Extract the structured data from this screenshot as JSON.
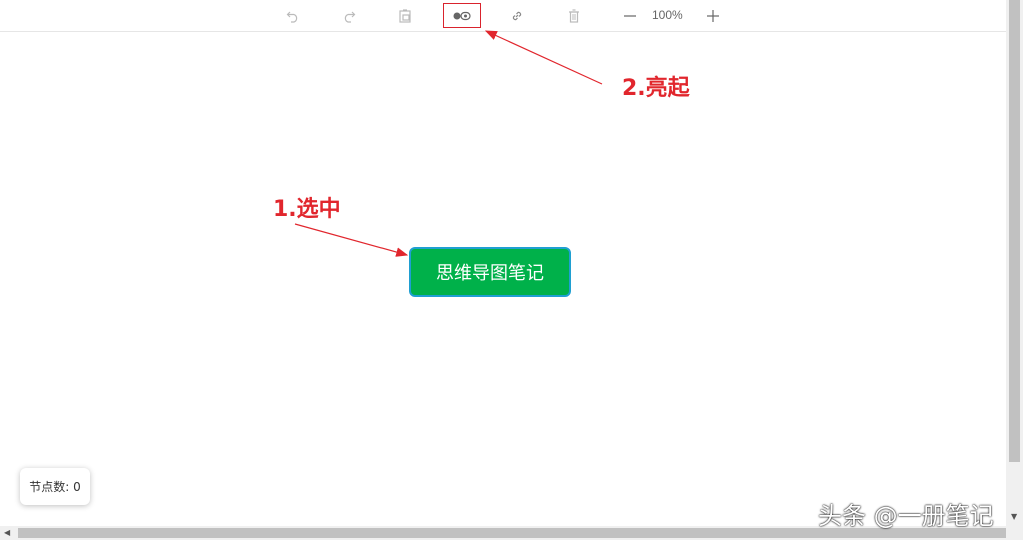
{
  "toolbar": {
    "undo_icon": "undo-icon",
    "redo_icon": "redo-icon",
    "paste_icon": "paste-icon",
    "toggle_icon": "toggle-icon",
    "link_icon": "link-icon",
    "delete_icon": "delete-icon",
    "zoom_out_icon": "minus-icon",
    "zoom_level": "100%",
    "zoom_in_icon": "plus-icon"
  },
  "canvas": {
    "root_node_label": "思维导图笔记",
    "node_count_label": "节点数: 0"
  },
  "annotations": {
    "step1": "1.选中",
    "step2": "2.亮起",
    "color": "#e1262d"
  },
  "colors": {
    "node_fill": "#00b14a",
    "node_border": "#1f9fd1",
    "highlight_border": "#d9232d"
  },
  "watermark": "头条 @一册笔记"
}
